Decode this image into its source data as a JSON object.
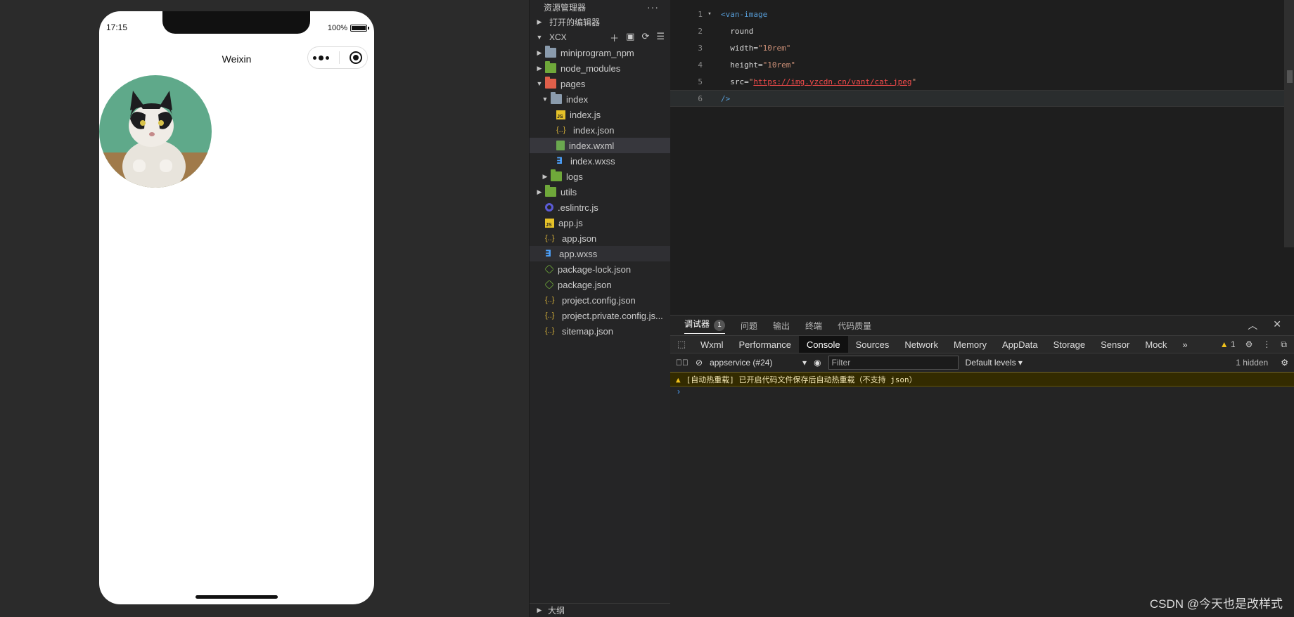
{
  "simulator": {
    "time": "17:15",
    "battery": "100%",
    "nav_title": "Weixin"
  },
  "explorer": {
    "title": "资源管理器",
    "more": "···",
    "open_editors": "打开的编辑器",
    "root": "XCX",
    "items": [
      {
        "label": "miniprogram_npm",
        "icon": "folder-icon",
        "indent": 1,
        "caret": "▶"
      },
      {
        "label": "node_modules",
        "icon": "folder-green-icon",
        "indent": 1,
        "caret": "▶"
      },
      {
        "label": "pages",
        "icon": "folder-red-icon",
        "indent": 1,
        "caret": "▼"
      },
      {
        "label": "index",
        "icon": "folder-open-icon",
        "indent": 2,
        "caret": "▼"
      },
      {
        "label": "index.js",
        "icon": "js-file-icon",
        "indent": 3,
        "caret": ""
      },
      {
        "label": "index.json",
        "icon": "json-file-icon",
        "indent": 3,
        "caret": ""
      },
      {
        "label": "index.wxml",
        "icon": "wxml-file-icon",
        "indent": 3,
        "caret": ""
      },
      {
        "label": "index.wxss",
        "icon": "wxss-file-icon",
        "indent": 3,
        "caret": ""
      },
      {
        "label": "logs",
        "icon": "folder-green-icon",
        "indent": 2,
        "caret": "▶"
      },
      {
        "label": "utils",
        "icon": "folder-green-icon",
        "indent": 1,
        "caret": "▶"
      },
      {
        "label": ".eslintrc.js",
        "icon": "eslint-file-icon",
        "indent": 1,
        "caret": ""
      },
      {
        "label": "app.js",
        "icon": "js-file-icon",
        "indent": 1,
        "caret": ""
      },
      {
        "label": "app.json",
        "icon": "json-file-icon",
        "indent": 1,
        "caret": ""
      },
      {
        "label": "app.wxss",
        "icon": "wxss-file-icon",
        "indent": 1,
        "caret": ""
      },
      {
        "label": "package-lock.json",
        "icon": "package-file-icon",
        "indent": 1,
        "caret": ""
      },
      {
        "label": "package.json",
        "icon": "package-file-icon",
        "indent": 1,
        "caret": ""
      },
      {
        "label": "project.config.json",
        "icon": "json-file-icon",
        "indent": 1,
        "caret": ""
      },
      {
        "label": "project.private.config.js...",
        "icon": "json-file-icon",
        "indent": 1,
        "caret": ""
      },
      {
        "label": "sitemap.json",
        "icon": "json-file-icon",
        "indent": 1,
        "caret": ""
      }
    ],
    "selected": "index.wxml",
    "highlighted": "app.wxss",
    "outline": "大纲"
  },
  "editor": {
    "lines": [
      {
        "num": "1",
        "tag": "<van-image",
        "attr": "",
        "val": ""
      },
      {
        "num": "2",
        "tag": "",
        "attr": "round",
        "val": ""
      },
      {
        "num": "3",
        "tag": "",
        "attr": "width=",
        "val": "\"10rem\""
      },
      {
        "num": "4",
        "tag": "",
        "attr": "height=",
        "val": "\"10rem\""
      },
      {
        "num": "5",
        "tag": "",
        "attr": "src=",
        "val": "https://img.yzcdn.cn/vant/cat.jpeg"
      },
      {
        "num": "6",
        "tag": "/>",
        "attr": "",
        "val": ""
      }
    ]
  },
  "debugger": {
    "tabs": [
      "调试器",
      "问题",
      "输出",
      "终端",
      "代码质量"
    ],
    "badge": "1",
    "devtools_tabs": [
      "Wxml",
      "Performance",
      "Console",
      "Sources",
      "Network",
      "Memory",
      "AppData",
      "Storage",
      "Sensor",
      "Mock"
    ],
    "active_devtab": "Console",
    "more_tabs": "»",
    "warn_count": "1",
    "context": "appservice (#24)",
    "filter_placeholder": "Filter",
    "levels": "Default levels",
    "hidden": "1 hidden",
    "warning": "[自动热重载] 已开启代码文件保存后自动热重载（不支持 json）",
    "prompt": "›"
  },
  "watermark": "CSDN @今天也是改样式"
}
